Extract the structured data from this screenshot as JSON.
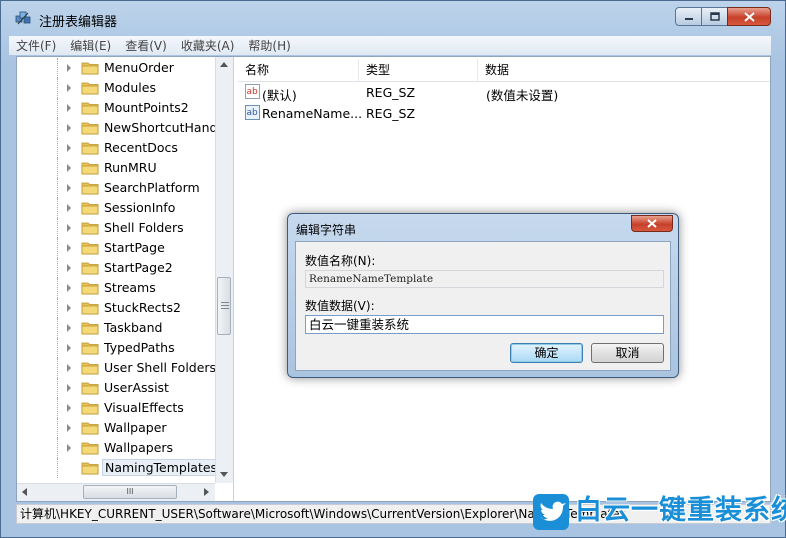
{
  "window": {
    "title": "注册表编辑器"
  },
  "menu": [
    {
      "label": "文件(F)"
    },
    {
      "label": "编辑(E)"
    },
    {
      "label": "查看(V)"
    },
    {
      "label": "收藏夹(A)"
    },
    {
      "label": "帮助(H)"
    }
  ],
  "tree": {
    "items": [
      {
        "label": "MenuOrder"
      },
      {
        "label": "Modules"
      },
      {
        "label": "MountPoints2"
      },
      {
        "label": "NewShortcutHandle"
      },
      {
        "label": "RecentDocs"
      },
      {
        "label": "RunMRU"
      },
      {
        "label": "SearchPlatform"
      },
      {
        "label": "SessionInfo"
      },
      {
        "label": "Shell Folders"
      },
      {
        "label": "StartPage"
      },
      {
        "label": "StartPage2"
      },
      {
        "label": "Streams"
      },
      {
        "label": "StuckRects2"
      },
      {
        "label": "Taskband"
      },
      {
        "label": "TypedPaths"
      },
      {
        "label": "User Shell Folders"
      },
      {
        "label": "UserAssist"
      },
      {
        "label": "VisualEffects"
      },
      {
        "label": "Wallpaper"
      },
      {
        "label": "Wallpapers"
      },
      {
        "label": "NamingTemplates"
      }
    ],
    "hscroll_grip": "III"
  },
  "list": {
    "columns": [
      {
        "label": "名称"
      },
      {
        "label": "类型"
      },
      {
        "label": "数据"
      }
    ],
    "rows": [
      {
        "name": "(默认)",
        "type": "REG_SZ",
        "data": "(数值未设置)"
      },
      {
        "name": "RenameName...",
        "type": "REG_SZ",
        "data": ""
      }
    ],
    "value_icon": "ab"
  },
  "status_path": "计算机\\HKEY_CURRENT_USER\\Software\\Microsoft\\Windows\\CurrentVersion\\Explorer\\NamingTemplates",
  "dialog": {
    "title": "编辑字符串",
    "name_label": "数值名称(N):",
    "name_value": "RenameNameTemplate",
    "data_label": "数值数据(V):",
    "data_value": "白云一键重装系统",
    "ok_label": "确定",
    "cancel_label": "取消"
  },
  "watermark": {
    "text": "白云一键重装系统"
  },
  "colors": {
    "folder": "#e8c357",
    "accent": "#1a8fd8",
    "close_red": "#c6402a"
  }
}
